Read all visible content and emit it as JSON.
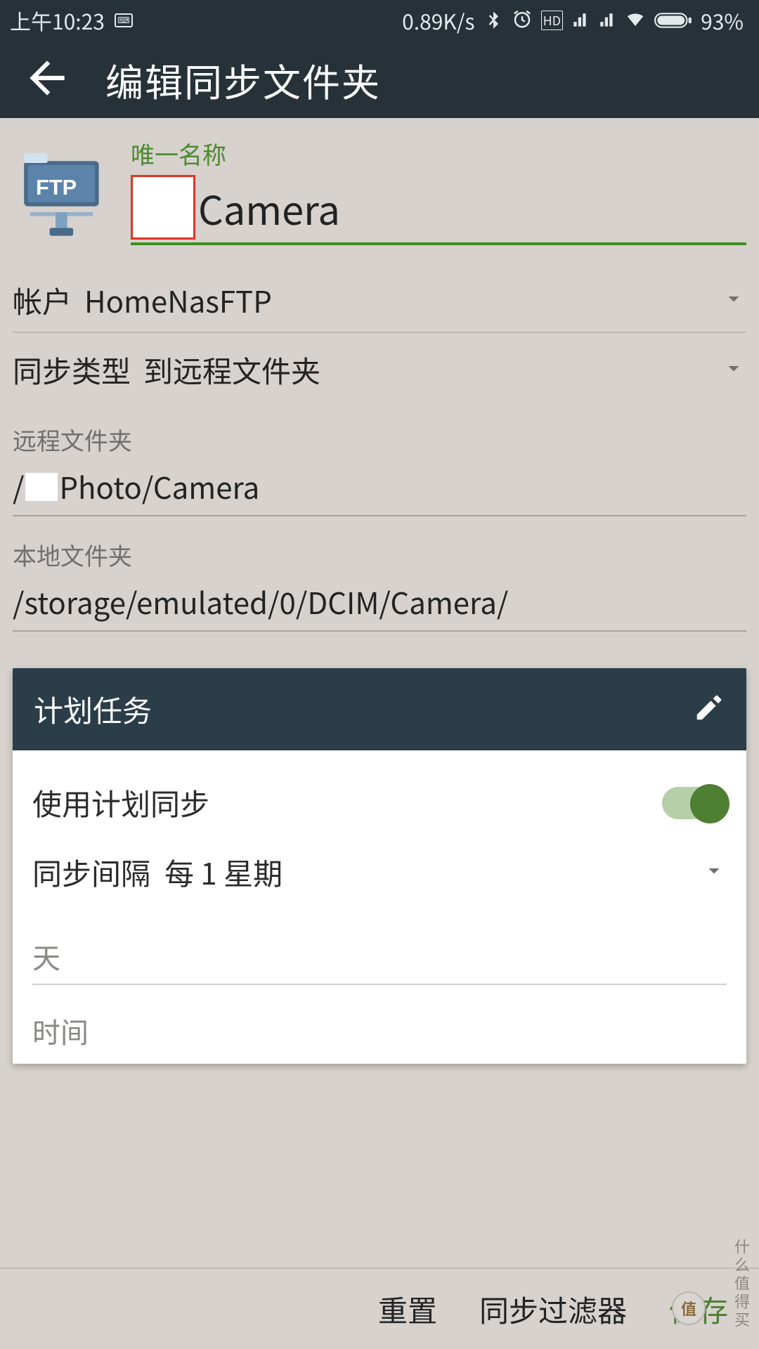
{
  "status": {
    "time": "上午10:23",
    "net_speed": "0.89K/s",
    "hd_badge": "HD",
    "battery_pct": "93%"
  },
  "header": {
    "title": "编辑同步文件夹"
  },
  "form": {
    "name_label": "唯一名称",
    "name_value": "Camera",
    "account_label": "帐户",
    "account_value": "HomeNasFTP",
    "sync_type_label": "同步类型",
    "sync_type_value": "到远程文件夹",
    "remote_label": "远程文件夹",
    "remote_prefix": "/",
    "remote_path_tail": "Photo/Camera",
    "local_label": "本地文件夹",
    "local_value": "/storage/emulated/0/DCIM/Camera/"
  },
  "schedule": {
    "card_title": "计划任务",
    "use_schedule_label": "使用计划同步",
    "use_schedule_on": true,
    "interval_label": "同步间隔",
    "interval_value": "每 1 星期",
    "day_label": "天",
    "time_label": "时间"
  },
  "footer": {
    "reset": "重置",
    "filter": "同步过滤器",
    "save": "保存"
  },
  "watermark": {
    "badge": "值",
    "text": "什么值得买"
  },
  "icons": {
    "folder_tag": "FTP"
  }
}
